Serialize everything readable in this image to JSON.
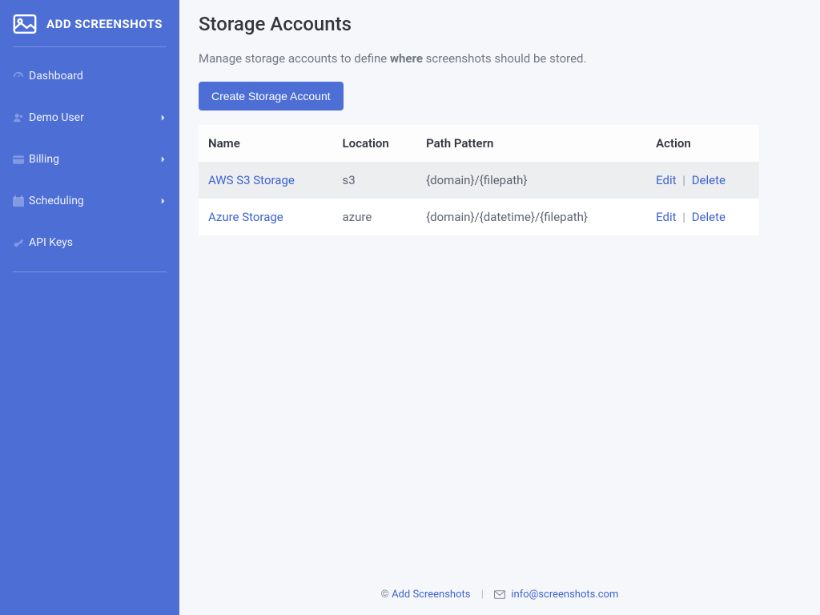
{
  "brand": {
    "title": "ADD SCREENSHOTS"
  },
  "sidebar": {
    "items": [
      {
        "label": "Dashboard",
        "icon": "dashboard-icon",
        "expandable": false
      },
      {
        "label": "Demo User",
        "icon": "user-icon",
        "expandable": true
      },
      {
        "label": "Billing",
        "icon": "card-icon",
        "expandable": true
      },
      {
        "label": "Scheduling",
        "icon": "calendar-icon",
        "expandable": true
      },
      {
        "label": "API Keys",
        "icon": "key-icon",
        "expandable": false
      }
    ]
  },
  "page": {
    "title": "Storage Accounts",
    "subtext_pre": "Manage storage accounts to define ",
    "subtext_bold": "where",
    "subtext_post": " screenshots should be stored.",
    "create_button": "Create Storage Account"
  },
  "table": {
    "headers": {
      "name": "Name",
      "location": "Location",
      "path": "Path Pattern",
      "action": "Action"
    },
    "actions": {
      "edit": "Edit",
      "delete": "Delete"
    },
    "rows": [
      {
        "name": "AWS S3 Storage",
        "location": "s3",
        "path": "{domain}/{filepath}"
      },
      {
        "name": "Azure Storage",
        "location": "azure",
        "path": "{domain}/{datetime}/{filepath}"
      }
    ]
  },
  "footer": {
    "copyright": "©",
    "brand_link": "Add Screenshots",
    "email": "info@screenshots.com"
  }
}
